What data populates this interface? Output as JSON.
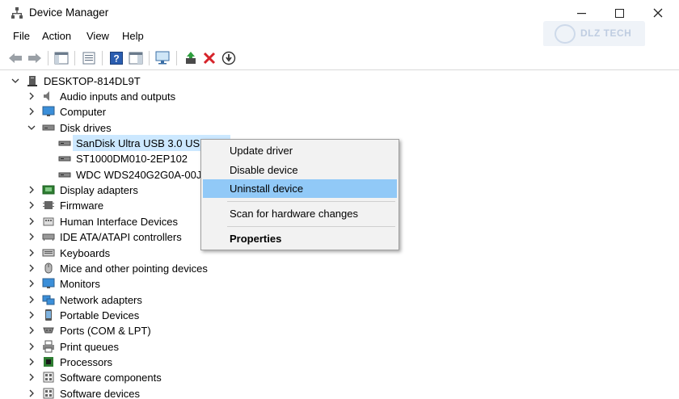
{
  "window": {
    "title": "Device Manager",
    "app_icon": "device-manager-icon",
    "controls": [
      "minimize",
      "maximize",
      "close"
    ],
    "close_glyph": "✕",
    "minimize_glyph": "—"
  },
  "menubar": {
    "items": [
      "File",
      "Action",
      "View",
      "Help"
    ]
  },
  "watermark": {
    "text": "DLZ TECH"
  },
  "toolbar": {
    "buttons": [
      "back-icon",
      "forward-icon",
      "show-hide-console-tree-icon",
      "properties-icon",
      "help-icon",
      "show-action-pane-icon",
      "scan-hardware-icon",
      "add-driver-icon",
      "uninstall-icon",
      "disable-device-icon"
    ]
  },
  "tree": {
    "root": "DESKTOP-814DL9T",
    "categories": [
      {
        "label": "Audio inputs and outputs",
        "icon": "speaker-icon",
        "expanded": false
      },
      {
        "label": "Computer",
        "icon": "monitor-icon",
        "expanded": false
      },
      {
        "label": "Disk drives",
        "icon": "disk-drive-icon",
        "expanded": true
      },
      {
        "label": "Display adapters",
        "icon": "display-adapter-icon",
        "expanded": false
      },
      {
        "label": "Firmware",
        "icon": "chip-icon",
        "expanded": false
      },
      {
        "label": "Human Interface Devices",
        "icon": "hid-icon",
        "expanded": false
      },
      {
        "label": "IDE ATA/ATAPI controllers",
        "icon": "controller-icon",
        "expanded": false
      },
      {
        "label": "Keyboards",
        "icon": "keyboard-icon",
        "expanded": false
      },
      {
        "label": "Mice and other pointing devices",
        "icon": "mouse-icon",
        "expanded": false
      },
      {
        "label": "Monitors",
        "icon": "monitor-icon",
        "expanded": false
      },
      {
        "label": "Network adapters",
        "icon": "network-icon",
        "expanded": false
      },
      {
        "label": "Portable Devices",
        "icon": "portable-device-icon",
        "expanded": false
      },
      {
        "label": "Ports (COM & LPT)",
        "icon": "port-icon",
        "expanded": false
      },
      {
        "label": "Print queues",
        "icon": "printer-icon",
        "expanded": false
      },
      {
        "label": "Processors",
        "icon": "processor-icon",
        "expanded": false
      },
      {
        "label": "Software components",
        "icon": "software-icon",
        "expanded": false
      },
      {
        "label": "Software devices",
        "icon": "software-icon",
        "expanded": false
      }
    ],
    "disk_drives": [
      {
        "label": "SanDisk Ultra USB 3.0 USB D",
        "selected": true
      },
      {
        "label": "ST1000DM010-2EP102",
        "selected": false
      },
      {
        "label": "WDC WDS240G2G0A-00JH3",
        "selected": false
      }
    ]
  },
  "context_menu": {
    "items": [
      {
        "label": "Update driver",
        "highlighted": false,
        "bold": false
      },
      {
        "label": "Disable device",
        "highlighted": false,
        "bold": false
      },
      {
        "label": "Uninstall device",
        "highlighted": true,
        "bold": false
      },
      {
        "label": "Scan for hardware changes",
        "highlighted": false,
        "bold": false
      },
      {
        "label": "Properties",
        "highlighted": false,
        "bold": true
      }
    ]
  },
  "colors": {
    "selection": "#cce8ff",
    "menu_highlight": "#91c9f7",
    "menu_bg": "#f2f2f2",
    "uninstall_red": "#d6232a"
  }
}
